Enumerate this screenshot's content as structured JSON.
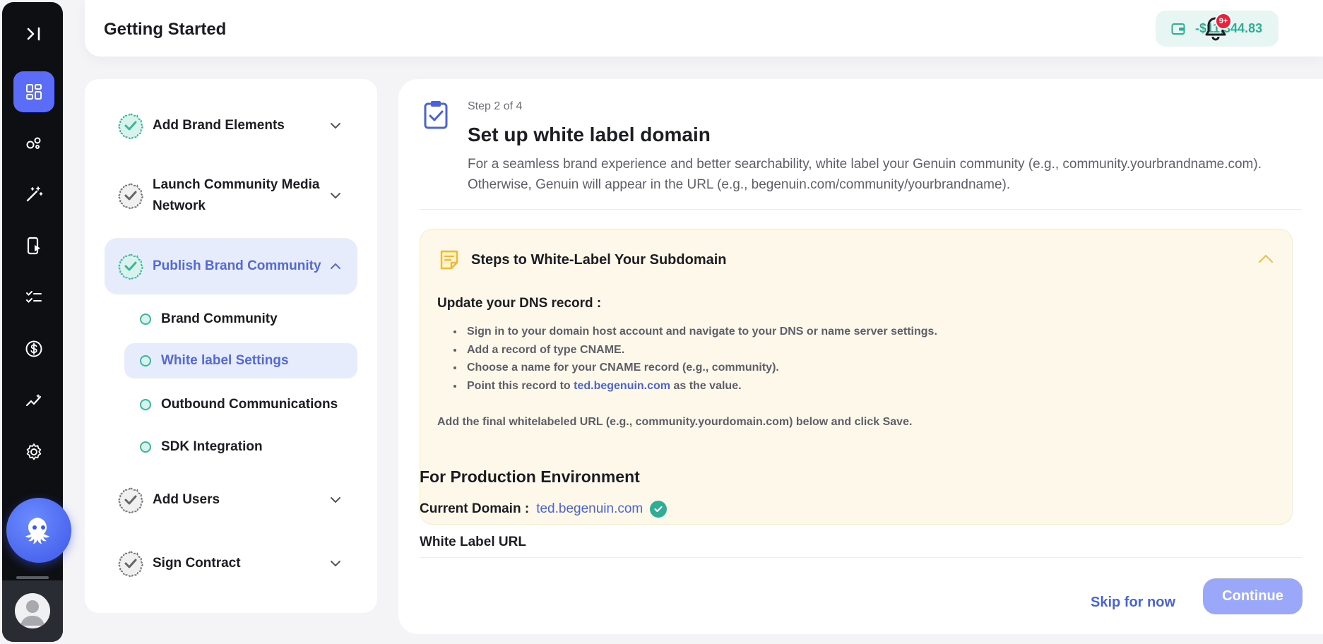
{
  "header": {
    "title": "Getting Started",
    "balance": "-$11,344.83",
    "notification_badge": "9+"
  },
  "rail": {
    "items": [
      "expand-icon",
      "dashboard-icon",
      "bubbles-icon",
      "magic-wand-icon",
      "phone-play-icon",
      "checklist-icon",
      "dollar-icon",
      "analytics-icon",
      "settings-icon"
    ],
    "active": "dashboard-icon"
  },
  "stepper": {
    "steps": [
      {
        "label": "Add Brand Elements",
        "state": "done"
      },
      {
        "label": "Launch Community Media Network",
        "state": "pending"
      },
      {
        "label": "Publish Brand Community",
        "state": "active"
      },
      {
        "label": "Add Users",
        "state": "pending"
      },
      {
        "label": "Sign Contract",
        "state": "pending"
      }
    ],
    "substeps": [
      {
        "label": "Brand Community"
      },
      {
        "label": "White label Settings",
        "active": true
      },
      {
        "label": "Outbound Communications"
      },
      {
        "label": "SDK Integration"
      }
    ]
  },
  "main": {
    "step_count": "Step 2 of 4",
    "title": "Set up white label domain",
    "description_line1": "For a seamless brand experience and better searchability, white label your Genuin community (e.g., community.yourbrandname.com).",
    "description_line2": "Otherwise, Genuin will appear in the URL (e.g., begenuin.com/community/yourbrandname).",
    "guide": {
      "title": "Steps to White-Label Your Subdomain",
      "dns_title": "Update your DNS record :",
      "items": [
        "Sign in to your domain host account and navigate to your DNS or name server settings.",
        "Add a record of type CNAME.",
        "Choose a name for your CNAME record (e.g., community)."
      ],
      "point_prefix": "Point this record to",
      "point_link": "ted.begenuin.com",
      "point_suffix": "as the value.",
      "footer": "Add the final whitelabeled URL (e.g., community.yourdomain.com) below and click Save."
    },
    "production": {
      "title": "For Production Environment",
      "current_domain_label": "Current Domain :",
      "current_domain_value": "ted.begenuin.com",
      "white_label_label": "White Label URL"
    },
    "buttons": {
      "skip": "Skip for now",
      "continue": "Continue"
    }
  },
  "colors": {
    "accent": "#5b6cf9",
    "success": "#2fae93",
    "link": "#4a63d9",
    "guide_bg": "#fdf8ea"
  }
}
